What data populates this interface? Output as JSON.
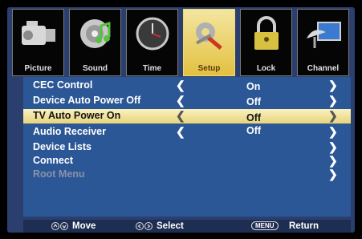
{
  "tabs": [
    {
      "label": "Picture",
      "icon": "camcorder-icon"
    },
    {
      "label": "Sound",
      "icon": "speaker-icon"
    },
    {
      "label": "Time",
      "icon": "clock-icon"
    },
    {
      "label": "Setup",
      "icon": "tools-icon"
    },
    {
      "label": "Lock",
      "icon": "padlock-icon"
    },
    {
      "label": "Channel",
      "icon": "satellite-dish-icon"
    }
  ],
  "active_tab": "Setup",
  "menu": [
    {
      "label": "CEC Control",
      "value": "On",
      "left_arrow": "❮",
      "right_arrow": "❯"
    },
    {
      "label": "Device Auto Power Off",
      "value": "Off",
      "left_arrow": "❮",
      "right_arrow": "❯"
    },
    {
      "label": "TV Auto Power On",
      "value": "Off",
      "left_arrow": "❮",
      "right_arrow": "❯",
      "selected": true
    },
    {
      "label": "Audio Receiver",
      "value": "Off",
      "left_arrow": "❮",
      "right_arrow": "❯"
    },
    {
      "label": "Device Lists",
      "value": "",
      "right_arrow": "❯"
    },
    {
      "label": "Connect",
      "value": "",
      "right_arrow": "❯"
    },
    {
      "label": "Root Menu",
      "value": "",
      "right_arrow": "❯",
      "disabled": true
    }
  ],
  "footer": {
    "move_icon": "up-down-arrows-icon",
    "move_label": "Move",
    "select_icon": "left-right-arrows-icon",
    "select_label": "Select",
    "return_key": "MENU",
    "return_label": "Return"
  },
  "colors": {
    "frame": "#2b3f6e",
    "menu_bg": "#2b5796",
    "highlight": "#f4e8a0",
    "active_tab": "#e8cc60"
  }
}
